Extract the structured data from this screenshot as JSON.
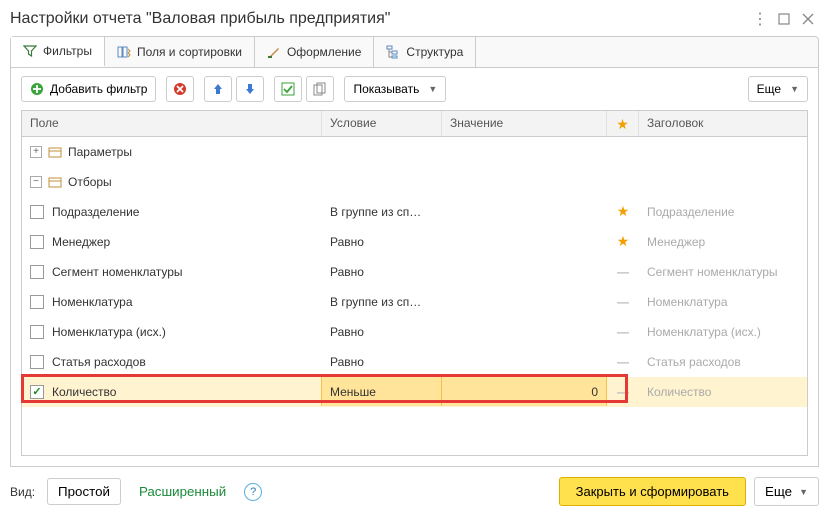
{
  "window": {
    "title": "Настройки отчета \"Валовая прибыль предприятия\""
  },
  "tabs": {
    "filters": "Фильтры",
    "fields": "Поля и сортировки",
    "design": "Оформление",
    "structure": "Структура"
  },
  "toolbar": {
    "add_filter": "Добавить фильтр",
    "show": "Показывать",
    "more": "Еще"
  },
  "columns": {
    "field": "Поле",
    "condition": "Условие",
    "value": "Значение",
    "title": "Заголовок"
  },
  "tree": {
    "params": "Параметры",
    "filters": "Отборы"
  },
  "rows": [
    {
      "checked": false,
      "field": "Подразделение",
      "cond": "В группе из сп…",
      "value": "",
      "star": "orange",
      "title": "Подразделение"
    },
    {
      "checked": false,
      "field": "Менеджер",
      "cond": "Равно",
      "value": "",
      "star": "orange",
      "title": "Менеджер"
    },
    {
      "checked": false,
      "field": "Сегмент номенклатуры",
      "cond": "Равно",
      "value": "",
      "star": "dash",
      "title": "Сегмент номенклатуры"
    },
    {
      "checked": false,
      "field": "Номенклатура",
      "cond": "В группе из сп…",
      "value": "",
      "star": "dash",
      "title": "Номенклатура"
    },
    {
      "checked": false,
      "field": "Номенклатура (исх.)",
      "cond": "Равно",
      "value": "",
      "star": "dash",
      "title": "Номенклатура (исх.)"
    },
    {
      "checked": false,
      "field": "Статья расходов",
      "cond": "Равно",
      "value": "",
      "star": "dash",
      "title": "Статья расходов"
    },
    {
      "checked": true,
      "field": "Количество",
      "cond": "Меньше",
      "value": "0",
      "star": "dash",
      "title": "Количество"
    }
  ],
  "footer": {
    "view": "Вид:",
    "simple": "Простой",
    "advanced": "Расширенный",
    "primary": "Закрыть и сформировать",
    "more": "Еще"
  }
}
